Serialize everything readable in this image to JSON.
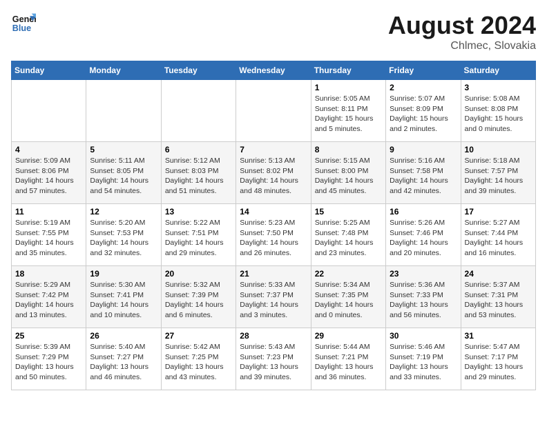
{
  "header": {
    "logo_line1": "General",
    "logo_line2": "Blue",
    "title": "August 2024",
    "subtitle": "Chlmec, Slovakia"
  },
  "weekdays": [
    "Sunday",
    "Monday",
    "Tuesday",
    "Wednesday",
    "Thursday",
    "Friday",
    "Saturday"
  ],
  "weeks": [
    [
      {
        "day": "",
        "info": ""
      },
      {
        "day": "",
        "info": ""
      },
      {
        "day": "",
        "info": ""
      },
      {
        "day": "",
        "info": ""
      },
      {
        "day": "1",
        "info": "Sunrise: 5:05 AM\nSunset: 8:11 PM\nDaylight: 15 hours\nand 5 minutes."
      },
      {
        "day": "2",
        "info": "Sunrise: 5:07 AM\nSunset: 8:09 PM\nDaylight: 15 hours\nand 2 minutes."
      },
      {
        "day": "3",
        "info": "Sunrise: 5:08 AM\nSunset: 8:08 PM\nDaylight: 15 hours\nand 0 minutes."
      }
    ],
    [
      {
        "day": "4",
        "info": "Sunrise: 5:09 AM\nSunset: 8:06 PM\nDaylight: 14 hours\nand 57 minutes."
      },
      {
        "day": "5",
        "info": "Sunrise: 5:11 AM\nSunset: 8:05 PM\nDaylight: 14 hours\nand 54 minutes."
      },
      {
        "day": "6",
        "info": "Sunrise: 5:12 AM\nSunset: 8:03 PM\nDaylight: 14 hours\nand 51 minutes."
      },
      {
        "day": "7",
        "info": "Sunrise: 5:13 AM\nSunset: 8:02 PM\nDaylight: 14 hours\nand 48 minutes."
      },
      {
        "day": "8",
        "info": "Sunrise: 5:15 AM\nSunset: 8:00 PM\nDaylight: 14 hours\nand 45 minutes."
      },
      {
        "day": "9",
        "info": "Sunrise: 5:16 AM\nSunset: 7:58 PM\nDaylight: 14 hours\nand 42 minutes."
      },
      {
        "day": "10",
        "info": "Sunrise: 5:18 AM\nSunset: 7:57 PM\nDaylight: 14 hours\nand 39 minutes."
      }
    ],
    [
      {
        "day": "11",
        "info": "Sunrise: 5:19 AM\nSunset: 7:55 PM\nDaylight: 14 hours\nand 35 minutes."
      },
      {
        "day": "12",
        "info": "Sunrise: 5:20 AM\nSunset: 7:53 PM\nDaylight: 14 hours\nand 32 minutes."
      },
      {
        "day": "13",
        "info": "Sunrise: 5:22 AM\nSunset: 7:51 PM\nDaylight: 14 hours\nand 29 minutes."
      },
      {
        "day": "14",
        "info": "Sunrise: 5:23 AM\nSunset: 7:50 PM\nDaylight: 14 hours\nand 26 minutes."
      },
      {
        "day": "15",
        "info": "Sunrise: 5:25 AM\nSunset: 7:48 PM\nDaylight: 14 hours\nand 23 minutes."
      },
      {
        "day": "16",
        "info": "Sunrise: 5:26 AM\nSunset: 7:46 PM\nDaylight: 14 hours\nand 20 minutes."
      },
      {
        "day": "17",
        "info": "Sunrise: 5:27 AM\nSunset: 7:44 PM\nDaylight: 14 hours\nand 16 minutes."
      }
    ],
    [
      {
        "day": "18",
        "info": "Sunrise: 5:29 AM\nSunset: 7:42 PM\nDaylight: 14 hours\nand 13 minutes."
      },
      {
        "day": "19",
        "info": "Sunrise: 5:30 AM\nSunset: 7:41 PM\nDaylight: 14 hours\nand 10 minutes."
      },
      {
        "day": "20",
        "info": "Sunrise: 5:32 AM\nSunset: 7:39 PM\nDaylight: 14 hours\nand 6 minutes."
      },
      {
        "day": "21",
        "info": "Sunrise: 5:33 AM\nSunset: 7:37 PM\nDaylight: 14 hours\nand 3 minutes."
      },
      {
        "day": "22",
        "info": "Sunrise: 5:34 AM\nSunset: 7:35 PM\nDaylight: 14 hours\nand 0 minutes."
      },
      {
        "day": "23",
        "info": "Sunrise: 5:36 AM\nSunset: 7:33 PM\nDaylight: 13 hours\nand 56 minutes."
      },
      {
        "day": "24",
        "info": "Sunrise: 5:37 AM\nSunset: 7:31 PM\nDaylight: 13 hours\nand 53 minutes."
      }
    ],
    [
      {
        "day": "25",
        "info": "Sunrise: 5:39 AM\nSunset: 7:29 PM\nDaylight: 13 hours\nand 50 minutes."
      },
      {
        "day": "26",
        "info": "Sunrise: 5:40 AM\nSunset: 7:27 PM\nDaylight: 13 hours\nand 46 minutes."
      },
      {
        "day": "27",
        "info": "Sunrise: 5:42 AM\nSunset: 7:25 PM\nDaylight: 13 hours\nand 43 minutes."
      },
      {
        "day": "28",
        "info": "Sunrise: 5:43 AM\nSunset: 7:23 PM\nDaylight: 13 hours\nand 39 minutes."
      },
      {
        "day": "29",
        "info": "Sunrise: 5:44 AM\nSunset: 7:21 PM\nDaylight: 13 hours\nand 36 minutes."
      },
      {
        "day": "30",
        "info": "Sunrise: 5:46 AM\nSunset: 7:19 PM\nDaylight: 13 hours\nand 33 minutes."
      },
      {
        "day": "31",
        "info": "Sunrise: 5:47 AM\nSunset: 7:17 PM\nDaylight: 13 hours\nand 29 minutes."
      }
    ]
  ]
}
